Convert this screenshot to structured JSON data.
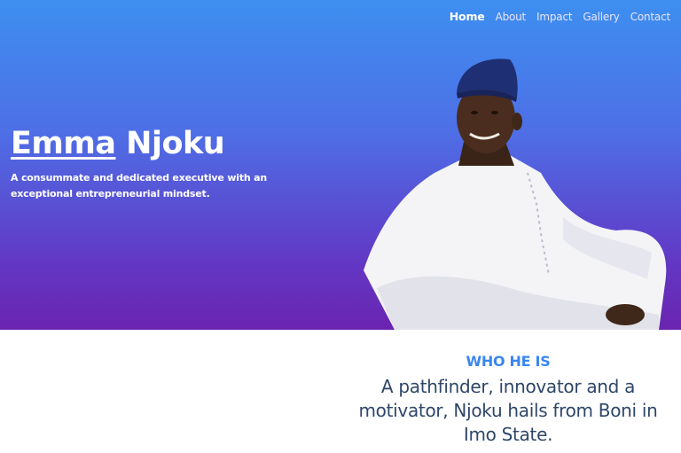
{
  "nav": {
    "items": [
      {
        "label": "Home",
        "active": true
      },
      {
        "label": "About"
      },
      {
        "label": "Impact"
      },
      {
        "label": "Gallery"
      },
      {
        "label": "Contact"
      }
    ]
  },
  "hero": {
    "first_name": "Emma",
    "last_name": "Njoku",
    "tagline": "A consummate and dedicated executive with an exceptional entrepreneurial mindset.",
    "gradient_top": "#3d8ff0",
    "gradient_bottom": "#6a24b0"
  },
  "about": {
    "eyebrow": "WHO HE IS",
    "lead": "A pathfinder, innovator and a motivator, Njoku hails from Boni in Imo State."
  },
  "colors": {
    "accent": "#3a86f0",
    "body_text": "#2e4668"
  }
}
